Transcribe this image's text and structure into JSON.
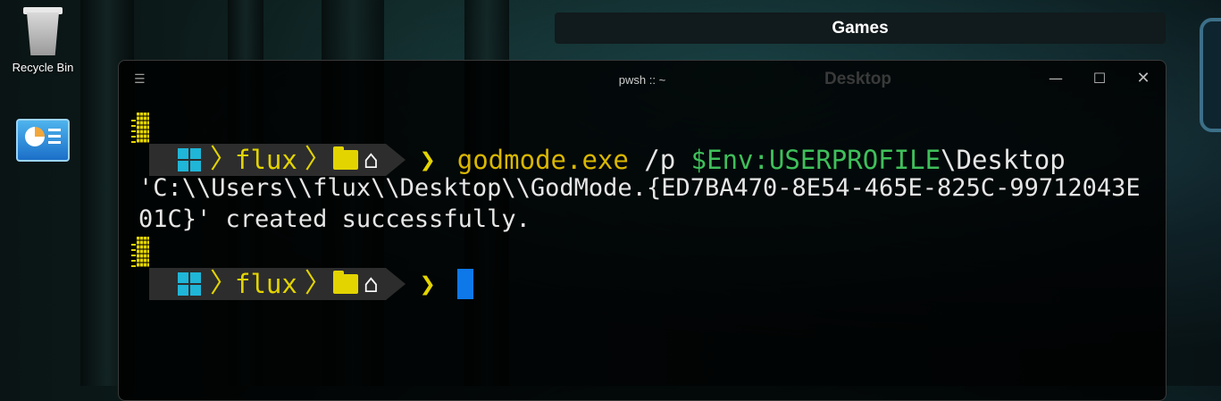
{
  "desktop": {
    "icons": [
      {
        "label": "Recycle Bin"
      },
      {
        "label": ""
      }
    ],
    "games_bar_label": "Games"
  },
  "terminal": {
    "title": "pwsh :: ~",
    "ghost_title": "Desktop",
    "menu_glyph": "☰",
    "controls": {
      "minimize": "—",
      "maximize": "☐",
      "close": "✕"
    },
    "prompt": {
      "os_icon": "windows-logo-icon",
      "user": "flux",
      "folder_icon": "folder-icon",
      "home_icon": "home-icon",
      "home_glyph": "⌂",
      "chevron": "❯"
    },
    "command": {
      "executable": "godmode.exe",
      "arg": " /p ",
      "env_var": "$Env:USERPROFILE",
      "path": "\\Desktop"
    },
    "output": "'C:\\\\Users\\\\flux\\\\Desktop\\\\GodMode.{ED7BA470-8E54-465E-825C-99712043E01C}' created successfully.",
    "colors": {
      "accent_yellow": "#e3d400",
      "env_green": "#3fbf5a",
      "cursor_blue": "#0e78e8",
      "segment_bg": "#2d2d2d"
    }
  }
}
